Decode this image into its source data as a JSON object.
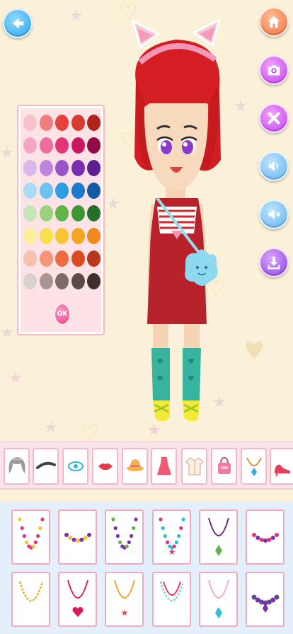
{
  "toolbar": {
    "back_icon": "arrow-left-icon",
    "home_icon": "home-icon",
    "camera_icon": "camera-icon",
    "reset_icon": "close-icon",
    "sound_icon": "speaker-icon",
    "music_icon": "speaker-mute-icon",
    "save_icon": "download-icon"
  },
  "palette": {
    "ok_label": "OK",
    "colors": [
      [
        "#f8c2cc",
        "#ef7e7e",
        "#e8403a",
        "#d93a2f",
        "#b0231c"
      ],
      [
        "#f5a6c4",
        "#ee6d9c",
        "#e53377",
        "#cc175f",
        "#900c46"
      ],
      [
        "#d8b7ea",
        "#bd86dc",
        "#9b53ca",
        "#7a2fb0",
        "#5c2090"
      ],
      [
        "#a9dcf6",
        "#6bc3f1",
        "#2b9ee3",
        "#1a7bcc",
        "#125aa3"
      ],
      [
        "#c6e6b8",
        "#9bd07c",
        "#61b34a",
        "#3d9634",
        "#22702a"
      ],
      [
        "#fbf09a",
        "#f8df4d",
        "#f7c533",
        "#f4a622",
        "#ef8a1e"
      ],
      [
        "#f7c1b0",
        "#f49677",
        "#ee6a3f",
        "#dd4a22",
        "#b5381a"
      ],
      [
        "#d7d2ce",
        "#a89692",
        "#7d6a66",
        "#5c4b45",
        "#3e302b"
      ]
    ]
  },
  "categories": [
    "hair",
    "eyebrows",
    "eyes",
    "lips",
    "hat",
    "dress",
    "jacket",
    "bag",
    "necklace",
    "shoes"
  ],
  "items": [
    {
      "kind": "bead-necklace",
      "colors": [
        "#e53377",
        "#f7c533"
      ]
    },
    {
      "kind": "short-bead-necklace",
      "colors": [
        "#7a2fb0",
        "#f7c533"
      ]
    },
    {
      "kind": "bead-necklace",
      "colors": [
        "#7a2fb0",
        "#61b34a"
      ]
    },
    {
      "kind": "star-necklace",
      "colors": [
        "#2bc0d8",
        "#e53377"
      ]
    },
    {
      "kind": "chain-pendant",
      "colors": [
        "#6d2a7a",
        "#61b34a"
      ]
    },
    {
      "kind": "collar-necklace",
      "colors": [
        "#e53377",
        "#7a2fb0"
      ]
    },
    {
      "kind": "gold-chain",
      "colors": [
        "#f4a622",
        "#f4a622"
      ]
    },
    {
      "kind": "heart-pendant",
      "colors": [
        "#d81b60",
        "#d81b60"
      ]
    },
    {
      "kind": "star-pendant",
      "colors": [
        "#f4a622",
        "#e8403a"
      ]
    },
    {
      "kind": "double-chain",
      "colors": [
        "#7fd6b8",
        "#e53377"
      ]
    },
    {
      "kind": "drop-pendant",
      "colors": [
        "#f5a6c4",
        "#2bc0d8"
      ]
    },
    {
      "kind": "jewel-collar",
      "colors": [
        "#5c4b8a",
        "#7a2fb0"
      ]
    }
  ]
}
